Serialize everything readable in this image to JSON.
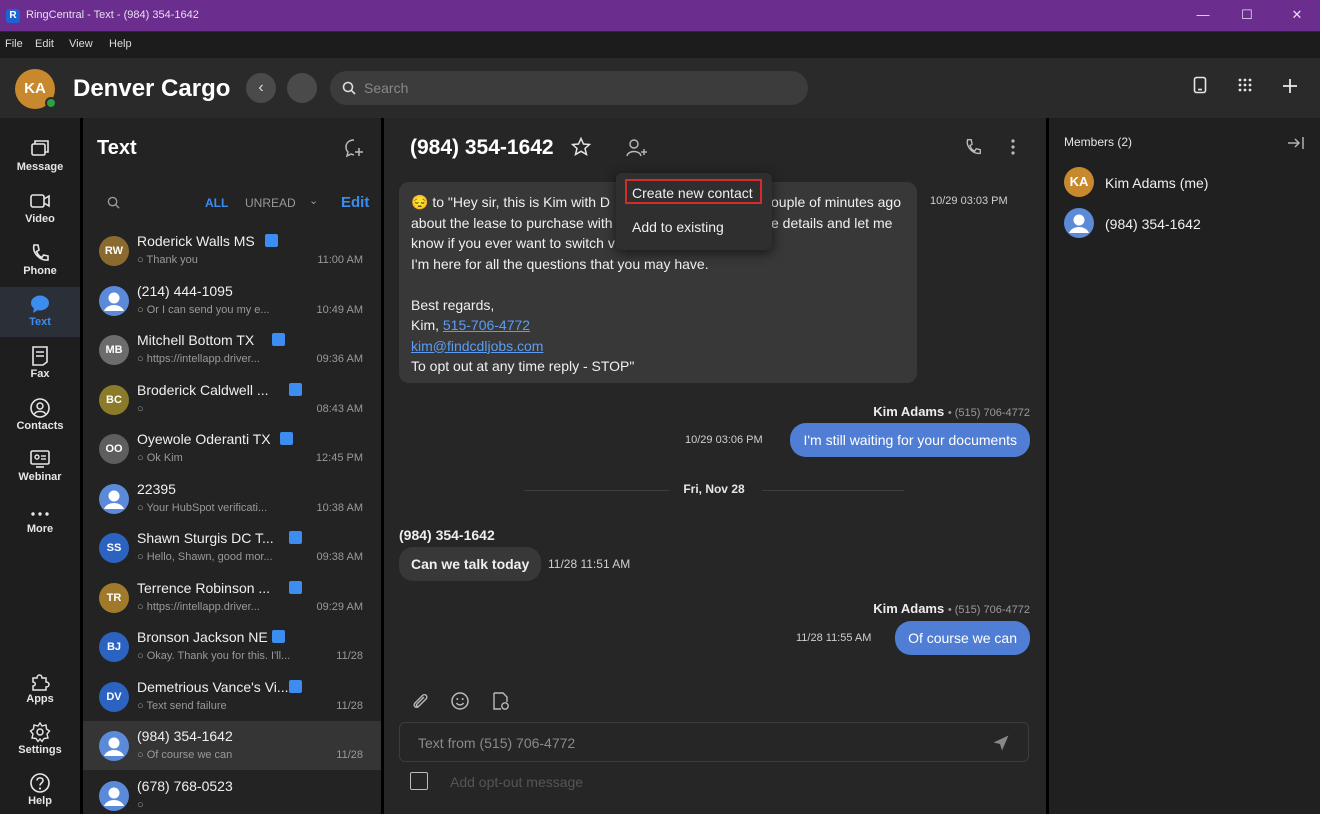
{
  "window": {
    "title": "RingCentral - Text - (984) 354-1642"
  },
  "menu": [
    "File",
    "Edit",
    "View",
    "Help"
  ],
  "header": {
    "avatar_initials": "KA",
    "org_title": "Denver Cargo",
    "search_placeholder": "Search"
  },
  "rail": {
    "items": [
      {
        "label": "Message",
        "icon": "message-icon"
      },
      {
        "label": "Video",
        "icon": "video-icon"
      },
      {
        "label": "Phone",
        "icon": "phone-icon"
      },
      {
        "label": "Text",
        "icon": "text-icon",
        "active": true
      },
      {
        "label": "Fax",
        "icon": "fax-icon"
      },
      {
        "label": "Contacts",
        "icon": "contacts-icon"
      },
      {
        "label": "Webinar",
        "icon": "webinar-icon"
      },
      {
        "label": "More",
        "icon": "more-icon"
      },
      {
        "label": "Apps",
        "icon": "apps-icon"
      },
      {
        "label": "Settings",
        "icon": "settings-icon"
      },
      {
        "label": "Help",
        "icon": "help-icon"
      }
    ]
  },
  "conversations": {
    "title": "Text",
    "filter_all": "ALL",
    "filter_unread": "UNREAD",
    "edit_label": "Edit",
    "items": [
      {
        "initials": "RW",
        "color": "#8b6a2f",
        "name": "Roderick Walls MS",
        "snippet": "Thank you",
        "time": "11:00 AM",
        "badge": true
      },
      {
        "initials": "",
        "color": "#5b8bd8",
        "name": "(214) 444-1095",
        "snippet": "Or I can send you my e...",
        "time": "10:49 AM",
        "badge": false
      },
      {
        "initials": "MB",
        "color": "#6c6c6c",
        "name": "Mitchell Bottom TX",
        "snippet": "https://intellapp.driver...",
        "time": "09:36 AM",
        "badge": true
      },
      {
        "initials": "BC",
        "color": "#8a7a2a",
        "name": "Broderick Caldwell ...",
        "snippet": "",
        "time": "08:43 AM",
        "badge": true
      },
      {
        "initials": "OO",
        "color": "#5e5e5e",
        "name": "Oyewole Oderanti TX",
        "snippet": "Ok Kim",
        "time": "12:45 PM",
        "badge": true
      },
      {
        "initials": "",
        "color": "#5b8bd8",
        "name": "22395",
        "snippet": "Your HubSpot verificati...",
        "time": "10:38 AM",
        "badge": false
      },
      {
        "initials": "SS",
        "color": "#2d63c0",
        "name": "Shawn Sturgis DC T...",
        "snippet": "Hello, Shawn, good mor...",
        "time": "09:38 AM",
        "badge": true
      },
      {
        "initials": "TR",
        "color": "#a07a2a",
        "name": "Terrence Robinson ...",
        "snippet": "https://intellapp.driver...",
        "time": "09:29 AM",
        "badge": true
      },
      {
        "initials": "BJ",
        "color": "#2d63c0",
        "name": "Bronson Jackson NE",
        "snippet": "Okay. Thank you for this. I'll...",
        "time": "11/28",
        "badge": true
      },
      {
        "initials": "DV",
        "color": "#2d63c0",
        "name": "Demetrious Vance's Vi...",
        "snippet": "Text send failure",
        "time": "11/28",
        "badge": true
      },
      {
        "initials": "",
        "color": "#5b8bd8",
        "name": "(984) 354-1642",
        "snippet": "Of course we can",
        "time": "11/28",
        "badge": false,
        "selected": true
      },
      {
        "initials": "",
        "color": "#5b8bd8",
        "name": "(678) 768-0523",
        "snippet": "",
        "time": "",
        "badge": false
      }
    ]
  },
  "chat": {
    "title": "(984) 354-1642",
    "long_message": {
      "emoji": "😔",
      "lines": [
        "to \"Hey sir, this is Kim with D",
        "about the lease to purchase with",
        "know if you ever want to switch v",
        "I'm here for all the questions that you may have.",
        "",
        "Best regards,"
      ],
      "line1_tail": "ouple of minutes ago",
      "line2_tail": "e details and let me",
      "signature_prefix": "Kim, ",
      "signature_phone": "515-706-4772",
      "email": "kim@findcdljobs.com",
      "optout_line": "To opt out at any time reply - STOP\"",
      "time": "10/29 03:03 PM"
    },
    "out_msg_1": {
      "sender": "Kim Adams",
      "sender_phone": "• (515) 706-4772",
      "time": "10/29 03:06 PM",
      "text": "I'm still waiting for your documents"
    },
    "date_separator": "Fri, Nov 28",
    "in_msg_1": {
      "sender": "(984) 354-1642",
      "text": "Can we talk today",
      "time": "11/28 11:51 AM"
    },
    "out_msg_2": {
      "sender": "Kim Adams",
      "sender_phone": "• (515) 706-4772",
      "time": "11/28 11:55 AM",
      "text": "Of course we can"
    },
    "compose_placeholder": "Text from (515) 706-4772",
    "optout_label": "Add opt-out message"
  },
  "dropdown": {
    "items": [
      "Create new contact",
      "Add to existing"
    ]
  },
  "members": {
    "title": "Members (2)",
    "items": [
      {
        "initials": "KA",
        "color": "#c8892e",
        "name": "Kim Adams (me)"
      },
      {
        "initials": "",
        "color": "#5b8bd8",
        "name": "(984) 354-1642"
      }
    ]
  }
}
